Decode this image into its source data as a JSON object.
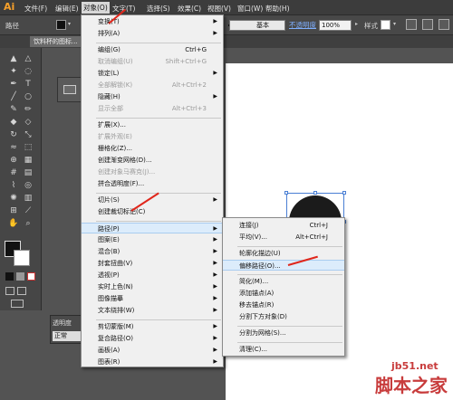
{
  "app": {
    "logo": "Ai"
  },
  "menubar": {
    "items": [
      "文件(F)",
      "编辑(E)",
      "对象(O)",
      "文字(T)",
      "选择(S)",
      "效果(C)",
      "视图(V)",
      "窗口(W)",
      "帮助(H)"
    ]
  },
  "controlbar": {
    "left_label": "路径",
    "stroke_style": "基本",
    "opacity_label": "不透明度",
    "opacity_value": "100%",
    "style_label": "样式"
  },
  "document": {
    "tab_title": "饮料杯的图标..."
  },
  "transparency_panel": {
    "title": "透明度",
    "mode": "正常"
  },
  "object_menu": {
    "items": [
      {
        "label": "变换(T)",
        "submenu": true
      },
      {
        "label": "排列(A)",
        "submenu": true
      },
      {
        "sep": true
      },
      {
        "label": "编组(G)",
        "shortcut": "Ctrl+G"
      },
      {
        "label": "取消编组(U)",
        "shortcut": "Shift+Ctrl+G",
        "disabled": true
      },
      {
        "label": "锁定(L)",
        "submenu": true
      },
      {
        "label": "全部解锁(K)",
        "shortcut": "Alt+Ctrl+2",
        "disabled": true
      },
      {
        "label": "隐藏(H)",
        "submenu": true
      },
      {
        "label": "显示全部",
        "shortcut": "Alt+Ctrl+3",
        "disabled": true
      },
      {
        "sep": true
      },
      {
        "label": "扩展(X)..."
      },
      {
        "label": "扩展外观(E)",
        "disabled": true
      },
      {
        "label": "栅格化(Z)..."
      },
      {
        "label": "创建渐变网格(D)..."
      },
      {
        "label": "创建对象马赛克(J)...",
        "disabled": true
      },
      {
        "label": "拼合透明度(F)..."
      },
      {
        "sep": true
      },
      {
        "label": "切片(S)",
        "submenu": true
      },
      {
        "label": "创建裁切标记(C)"
      },
      {
        "sep": true
      },
      {
        "label": "路径(P)",
        "submenu": true,
        "highlighted": true
      },
      {
        "label": "图案(E)",
        "submenu": true
      },
      {
        "label": "混合(B)",
        "submenu": true
      },
      {
        "label": "封套扭曲(V)",
        "submenu": true
      },
      {
        "label": "透视(P)",
        "submenu": true
      },
      {
        "label": "实时上色(N)",
        "submenu": true
      },
      {
        "label": "图像描摹",
        "submenu": true
      },
      {
        "label": "文本绕排(W)",
        "submenu": true
      },
      {
        "sep": true
      },
      {
        "label": "剪切蒙版(M)",
        "submenu": true
      },
      {
        "label": "复合路径(O)",
        "submenu": true
      },
      {
        "label": "画板(A)",
        "submenu": true
      },
      {
        "label": "图表(R)",
        "submenu": true
      }
    ]
  },
  "path_submenu": {
    "items": [
      {
        "label": "连接(J)",
        "shortcut": "Ctrl+J"
      },
      {
        "label": "平均(V)...",
        "shortcut": "Alt+Ctrl+J"
      },
      {
        "sep": true
      },
      {
        "label": "轮廓化描边(U)"
      },
      {
        "label": "偏移路径(O)...",
        "highlighted": true
      },
      {
        "sep": true
      },
      {
        "label": "简化(M)..."
      },
      {
        "label": "添加锚点(A)"
      },
      {
        "label": "移去锚点(R)"
      },
      {
        "label": "分割下方对象(D)"
      },
      {
        "sep": true
      },
      {
        "label": "分割为网格(S)..."
      },
      {
        "sep": true
      },
      {
        "label": "清理(C)..."
      }
    ]
  },
  "watermark": {
    "line1": "jb51.net",
    "line2": "脚本之家"
  },
  "colors": {
    "accent_orange": "#f7a02a",
    "arrow_red": "#e0261b",
    "highlight": "#dcecfb"
  }
}
